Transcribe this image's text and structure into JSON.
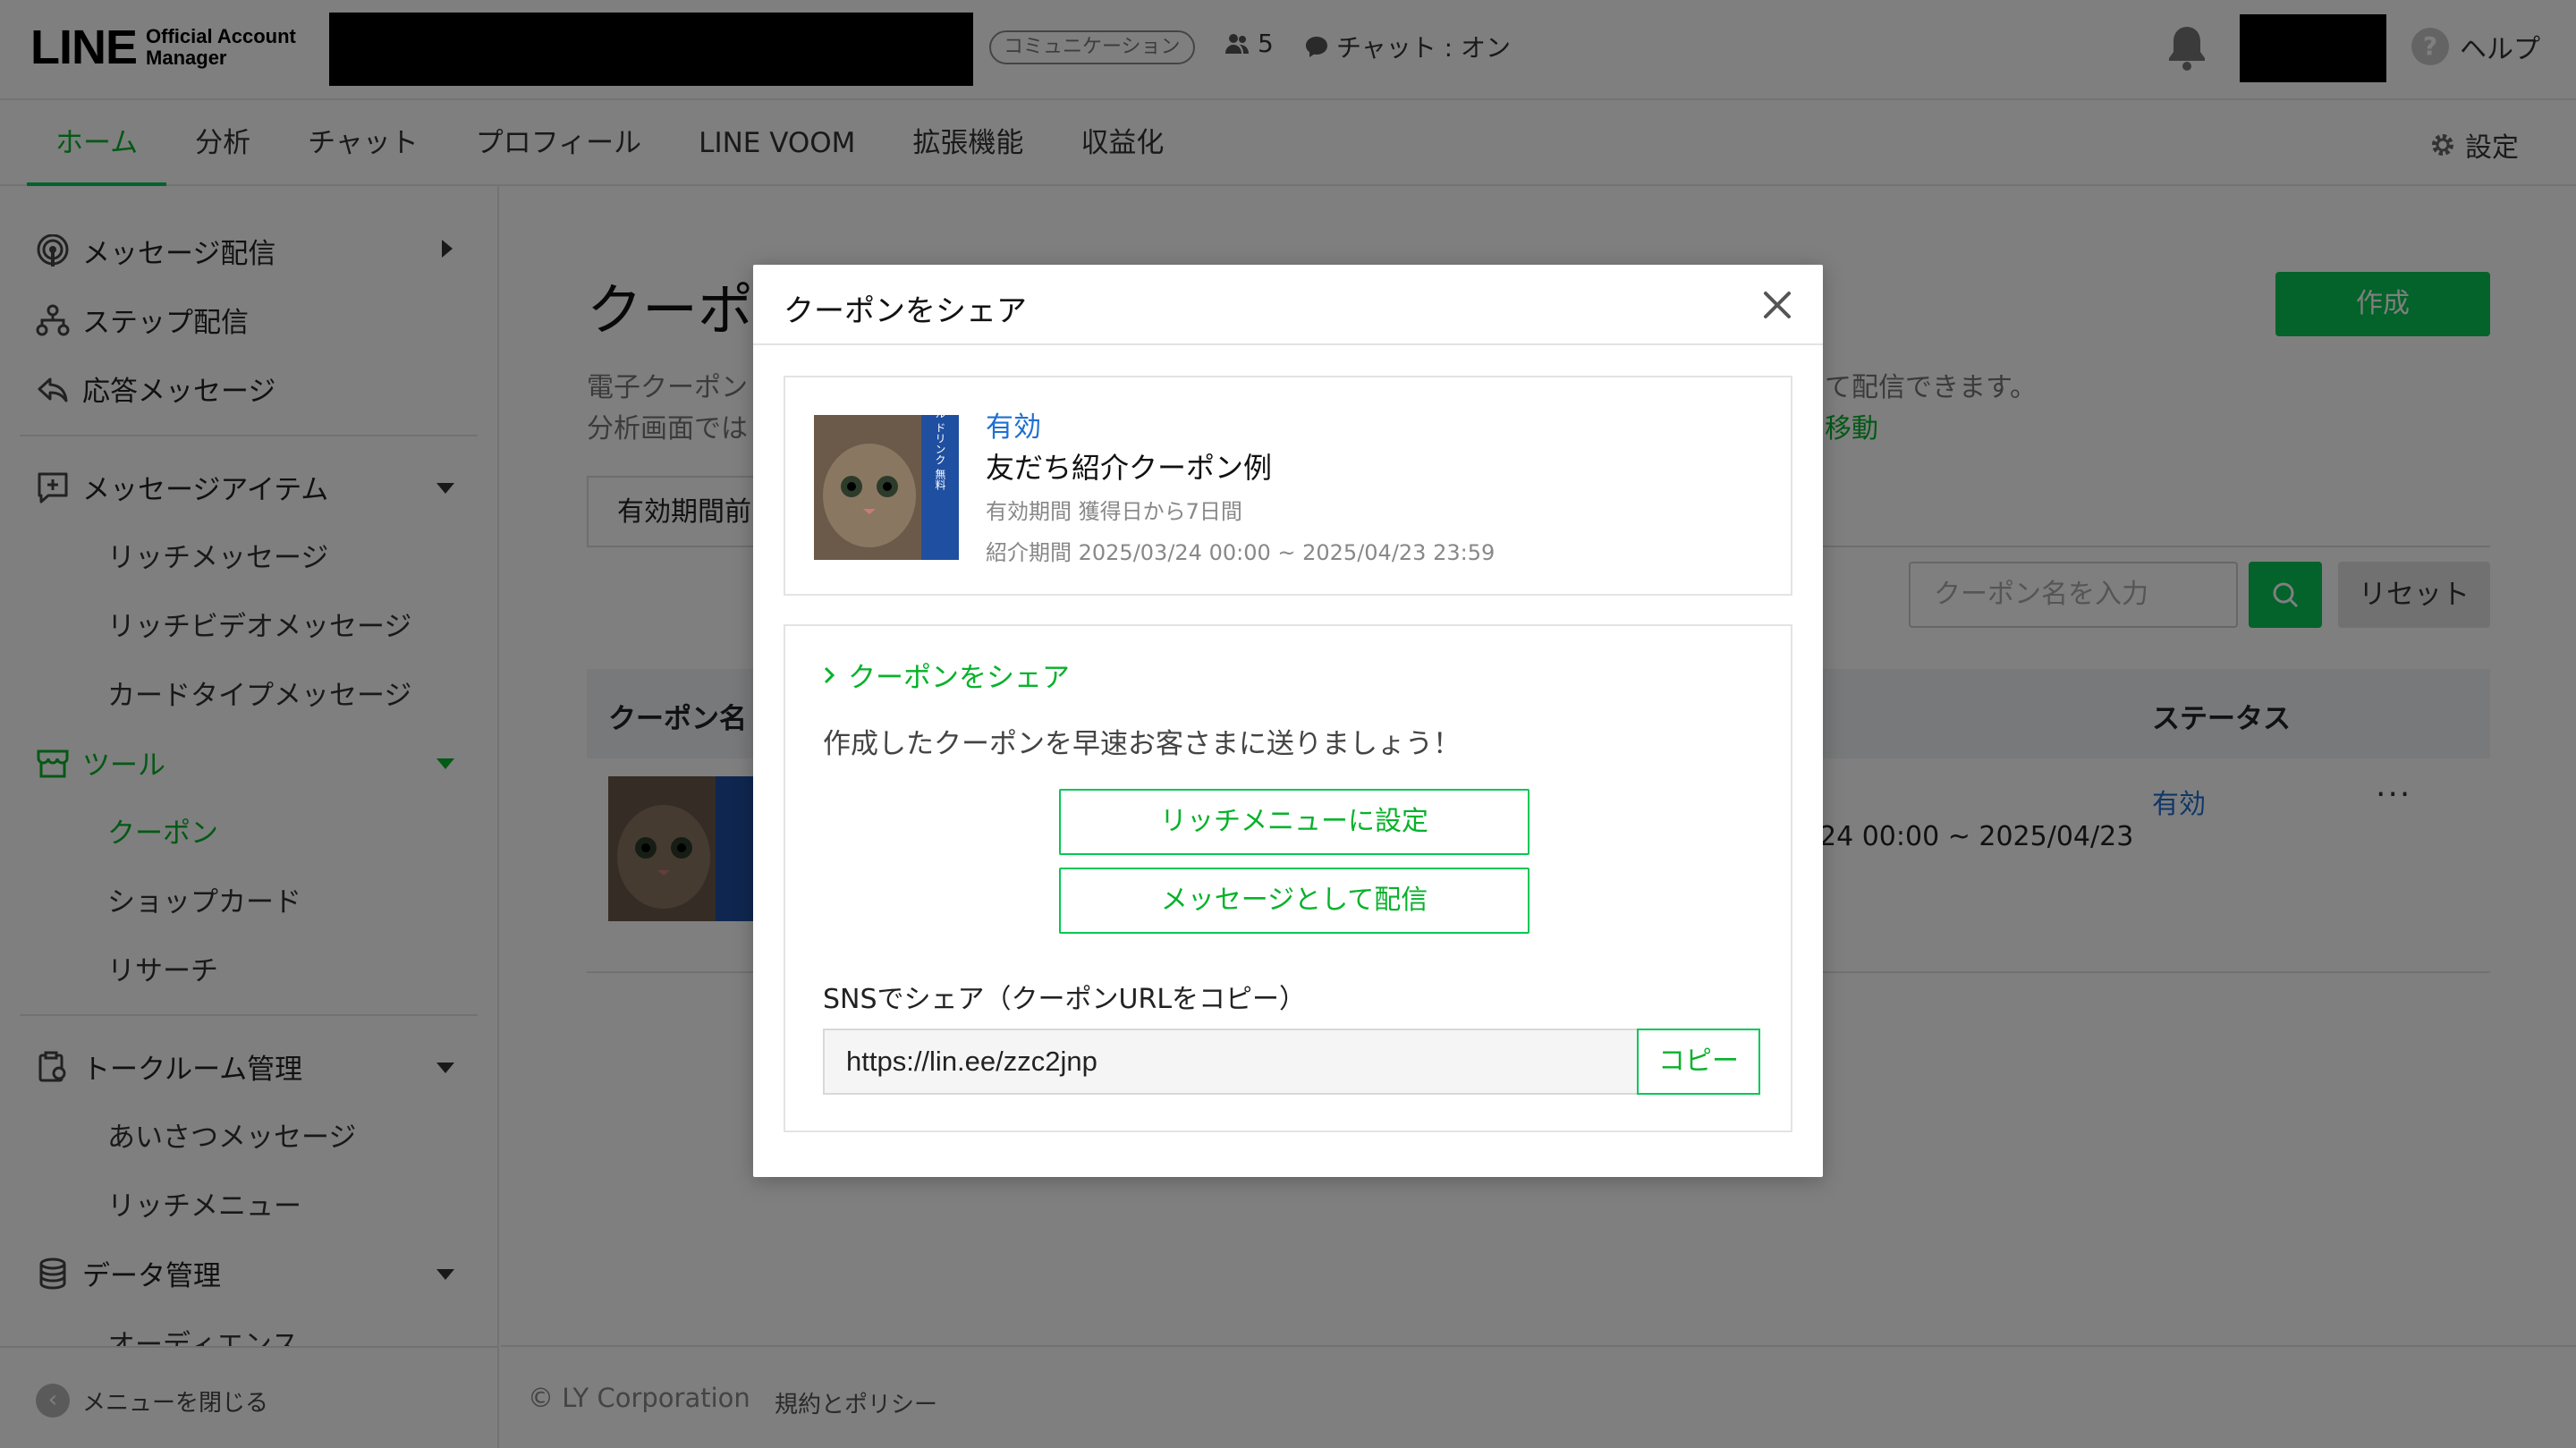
{
  "header": {
    "logo_main": "LINE",
    "logo_sub_line1": "Official Account",
    "logo_sub_line2": "Manager",
    "account_type_badge": "コミュニケーション",
    "friends_count": "5",
    "chat_mode": "チャット : オン",
    "help_label": "ヘルプ",
    "help_icon_glyph": "?"
  },
  "nav": {
    "tabs": [
      {
        "label": "ホーム",
        "active": true
      },
      {
        "label": "分析",
        "active": false
      },
      {
        "label": "チャット",
        "active": false
      },
      {
        "label": "プロフィール",
        "active": false
      },
      {
        "label": "LINE VOOM",
        "active": false
      },
      {
        "label": "拡張機能",
        "active": false
      },
      {
        "label": "収益化",
        "active": false
      }
    ],
    "settings_label": "設定"
  },
  "sidebar": {
    "message_delivery": "メッセージ配信",
    "step_delivery": "ステップ配信",
    "auto_reply": "応答メッセージ",
    "message_items": "メッセージアイテム",
    "rich_message": "リッチメッセージ",
    "rich_video_message": "リッチビデオメッセージ",
    "card_type_message": "カードタイプメッセージ",
    "tools": "ツール",
    "coupon": "クーポン",
    "shop_card": "ショップカード",
    "research": "リサーチ",
    "talk_room": "トークルーム管理",
    "greeting_message": "あいさつメッセージ",
    "rich_menu": "リッチメニュー",
    "data_management": "データ管理",
    "audience": "オーディエンス",
    "close_menu": "メニューを閉じる",
    "close_icon_glyph": "‹"
  },
  "main": {
    "page_title": "クーポ",
    "create_button": "作成",
    "desc_line1_left": "電子クーポン",
    "desc_line1_right": "て配信できます。",
    "desc_line2_left": "分析画面では",
    "desc_line2_link": "移動",
    "filter_tab": "有効期間前",
    "search_placeholder": "クーポン名を入力",
    "reset_button": "リセット",
    "col_name": "クーポン名",
    "col_status": "ステータス",
    "row_status": "有効",
    "row_period_fragment": "24 00:00 ~ 2025/04/23",
    "row_more": "···"
  },
  "footer": {
    "copyright": "© LY Corporation",
    "terms": "規約とポリシー"
  },
  "modal": {
    "title": "クーポンをシェア",
    "coupon": {
      "status": "有効",
      "name": "友だち紹介クーポン例",
      "validity": "有効期間 獲得日から7日間",
      "referral_period": "紹介期間 2025/03/24 00:00 ~ 2025/04/23 23:59",
      "thumb_text": "サンプル ドリンク 無料"
    },
    "share": {
      "heading": "クーポンをシェア",
      "description": "作成したクーポンを早速お客さまに送りましょう！",
      "rich_menu_button": "リッチメニューに設定",
      "message_button": "メッセージとして配信",
      "sns_label": "SNSでシェア（クーポンURLをコピー）",
      "url": "https://lin.ee/zzc2jnp",
      "copy_button": "コピー"
    }
  },
  "colors": {
    "brand_green": "#06c755",
    "link_blue": "#1f6fd1"
  }
}
